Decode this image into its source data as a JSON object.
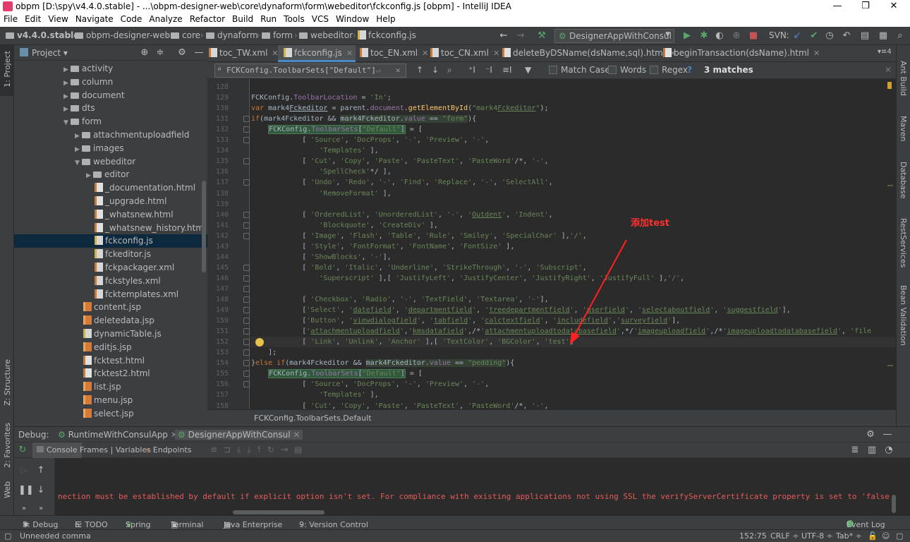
{
  "window": {
    "title": "obpm [D:\\spy\\v4.4.0.stable] - ...\\obpm-designer-web\\core\\dynaform\\form\\webeditor\\fckconfig.js [obpm] - IntelliJ IDEA",
    "minimize": "—",
    "maximize": "❐",
    "close": "✕"
  },
  "menu": [
    "File",
    "Edit",
    "View",
    "Navigate",
    "Code",
    "Analyze",
    "Refactor",
    "Build",
    "Run",
    "Tools",
    "VCS",
    "Window",
    "Help"
  ],
  "breadcrumb": [
    "v4.4.0.stable",
    "obpm-designer-web",
    "core",
    "dynaform",
    "form",
    "webeditor",
    "fckconfig.js"
  ],
  "run_config": "DesignerAppWithConsul",
  "svn_label": "SVN:",
  "left_strip": {
    "project": "1: Project",
    "structure": "Z: Structure",
    "favorites": "2: Favorites",
    "web": "Web"
  },
  "right_strip": [
    "Ant Build",
    "Maven",
    "Database",
    "RestServices",
    "Bean Validation"
  ],
  "project_panel": {
    "title": "Project",
    "items": [
      {
        "label": "activity",
        "type": "folder",
        "expanded": false
      },
      {
        "label": "column",
        "type": "folder",
        "expanded": false
      },
      {
        "label": "document",
        "type": "folder",
        "expanded": false
      },
      {
        "label": "dts",
        "type": "folder",
        "expanded": false
      },
      {
        "label": "form",
        "type": "folder",
        "expanded": true
      },
      {
        "label": "attachmentuploadfield",
        "type": "folder",
        "expanded": false
      },
      {
        "label": "images",
        "type": "folder",
        "expanded": false
      },
      {
        "label": "webeditor",
        "type": "folder",
        "expanded": true
      },
      {
        "label": "editor",
        "type": "folder",
        "expanded": false
      },
      {
        "label": "_documentation.html",
        "type": "html"
      },
      {
        "label": "_upgrade.html",
        "type": "html"
      },
      {
        "label": "_whatsnew.html",
        "type": "html"
      },
      {
        "label": "_whatsnew_history.html",
        "type": "html"
      },
      {
        "label": "fckconfig.js",
        "type": "js",
        "selected": true
      },
      {
        "label": "fckeditor.js",
        "type": "js"
      },
      {
        "label": "fckpackager.xml",
        "type": "xml"
      },
      {
        "label": "fckstyles.xml",
        "type": "xml"
      },
      {
        "label": "fcktemplates.xml",
        "type": "xml"
      },
      {
        "label": "content.jsp",
        "type": "jsp"
      },
      {
        "label": "deletedata.jsp",
        "type": "jsp"
      },
      {
        "label": "dynamicTable.js",
        "type": "js"
      },
      {
        "label": "editjs.jsp",
        "type": "jsp"
      },
      {
        "label": "fcktest.html",
        "type": "html"
      },
      {
        "label": "fcktest2.html",
        "type": "html"
      },
      {
        "label": "list.jsp",
        "type": "jsp"
      },
      {
        "label": "menu.jsp",
        "type": "jsp"
      },
      {
        "label": "select.jsp",
        "type": "jsp"
      }
    ]
  },
  "editor_tabs": [
    {
      "label": "toc_TW.xml"
    },
    {
      "label": "fckconfig.js",
      "active": true
    },
    {
      "label": "toc_EN.xml"
    },
    {
      "label": "toc_CN.xml"
    },
    {
      "label": "deleteByDSName(dsName,sql).html"
    },
    {
      "label": "beginTransaction(dsName).html"
    }
  ],
  "find": {
    "query": "FCKConfig.ToolbarSets[\"Default\"]",
    "match_case": "Match Case",
    "words": "Words",
    "regex": "Regex",
    "help": "?",
    "matches": "3 matches"
  },
  "code_lines": [
    {
      "n": "128",
      "html": ""
    },
    {
      "n": "129",
      "html": "FCKConfig.<span class=\"fld\">ToolbarLocation</span> = <span class=\"str\">'In'</span>;"
    },
    {
      "n": "130",
      "html": "<span class=\"kw\">var</span> mark4<u>Fckeditor</u> = parent.<span class=\"fld\">document</span>.<span class=\"fn\">getElementById</span>(<span class=\"str\">\"mark4<u>Fckeditor</u>\"</span>);"
    },
    {
      "n": "131",
      "html": "<span class=\"kw\">if</span>(mark4Fckeditor &amp;&amp; <span style=\"background:#344134\">mark4Fckeditor.<span class=\"fld\">value</span> == <span class=\"str\">\"form\"</span></span>){"
    },
    {
      "n": "132",
      "html": "    <span class=\"hl\">FCKConfig.<span class=\"fld\">ToolbarSets</span>[<span class=\"str\">\"Default\"</span>]</span> = ["
    },
    {
      "n": "133",
      "html": "            [ <span class=\"str\">'Source'</span>, <span class=\"str\">'DocProps'</span>, <span class=\"str\">'-'</span>, <span class=\"str\">'Preview'</span>, <span class=\"str\">'-'</span>,"
    },
    {
      "n": "134",
      "html": "                <span class=\"str\">'Templates'</span> ],"
    },
    {
      "n": "135",
      "html": "            [ <span class=\"str\">'Cut'</span>, <span class=\"str\">'Copy'</span>, <span class=\"str\">'Paste'</span>, <span class=\"str\">'PasteText'</span>, <span class=\"str\">'PasteWord'</span>/*, <span class=\"str\">'-'</span>,"
    },
    {
      "n": "136",
      "html": "                <span class=\"str\">'SpellCheck'</span>*/ ],"
    },
    {
      "n": "137",
      "html": "            [ <span class=\"str\">'Undo'</span>, <span class=\"str\">'Redo'</span>, <span class=\"str\">'-'</span>, <span class=\"str\">'Find'</span>, <span class=\"str\">'Replace'</span>, <span class=\"str\">'-'</span>, <span class=\"str\">'SelectAll'</span>,"
    },
    {
      "n": "138",
      "html": "                <span class=\"str\">'RemoveFormat'</span> ],"
    },
    {
      "n": "139",
      "html": ""
    },
    {
      "n": "140",
      "html": "            [ <span class=\"str\">'OrderedList'</span>, <span class=\"str\">'UnorderedList'</span>, <span class=\"str\">'-'</span>, <span class=\"str\">'<u>Outdent</u>'</span>, <span class=\"str\">'Indent'</span>,"
    },
    {
      "n": "141",
      "html": "                <span class=\"str\">'Blockquote'</span>, <span class=\"str\">'CreateDiv'</span> ],"
    },
    {
      "n": "142",
      "html": "            [ <span class=\"str\">'Image'</span>, <span class=\"str\">'Flash'</span>, <span class=\"str\">'Table'</span>, <span class=\"str\">'Rule'</span>, <span class=\"str\">'Smiley'</span>, <span class=\"str\">'SpecialChar'</span> ],<span class=\"str\">'/'</span>,"
    },
    {
      "n": "143",
      "html": "            [ <span class=\"str\">'Style'</span>, <span class=\"str\">'FontFormat'</span>, <span class=\"str\">'FontName'</span>, <span class=\"str\">'FontSize'</span> ],"
    },
    {
      "n": "144",
      "html": "            [ <span class=\"str\">'ShowBlocks'</span>, <span class=\"str\">'-'</span>],"
    },
    {
      "n": "145",
      "html": "            [ <span class=\"str\">'Bold'</span>, <span class=\"str\">'Italic'</span>, <span class=\"str\">'Underline'</span>, <span class=\"str\">'StrikeThrough'</span>, <span class=\"str\">'-'</span>, <span class=\"str\">'Subscript'</span>,"
    },
    {
      "n": "146",
      "html": "                <span class=\"str\">'Superscript'</span> ],[ <span class=\"str\">'JustifyLeft'</span>, <span class=\"str\">'JustifyCenter'</span>, <span class=\"str\">'JustifyRight'</span>, <span class=\"str\">'JustifyFull'</span> ],<span class=\"str\">'/'</span>,"
    },
    {
      "n": "147",
      "html": ""
    },
    {
      "n": "148",
      "html": "            [ <span class=\"str\">'Checkbox'</span>, <span class=\"str\">'Radio'</span>, <span class=\"str\">'-'</span>, <span class=\"str\">'TextField'</span>, <span class=\"str\">'Textarea'</span>, <span class=\"str\">'-'</span>],"
    },
    {
      "n": "149",
      "html": "            [<span class=\"str\">'Select'</span>, <span class=\"str\">'<u>datefield</u>'</span>, <span class=\"str\">'<u>departmentfield</u>'</span>, <span class=\"str\">'<u>treedepartmentfield</u>'</span>, <span class=\"str\">'<u>userfield</u>'</span>, <span class=\"str\">'<u>selectaboutfield</u>'</span>, <span class=\"str\">'<u>suggestfield</u>'</span>],"
    },
    {
      "n": "150",
      "html": "            [<span class=\"str\">'Button'</span>, <span class=\"str\">'<u>viewdialogfield</u>'</span>, <span class=\"str\">'<u>tabfield</u>'</span>, <span class=\"str\">'<u>calctextfield</u>'</span>, <span class=\"str\">'<u>includefield</u>'</span>,<span class=\"str\">'<u>surveyfield</u>'</span>],"
    },
    {
      "n": "151",
      "html": "            [<span class=\"str\">'<u>attachmentuploadfield</u>'</span>,<span class=\"str\">'<u>kmsdatafield</u>'</span>,/*<span class=\"str\">'<u>attachmentuploadtodatabasefield</u>'</span>,*/<span class=\"str\">'<u>imageuploadfield</u>'</span>,/*<span class=\"str\">'<u>imageuploadtodatabasefield</u>'</span>, <span class=\"str\">'file</span>"
    },
    {
      "n": "152",
      "html": "            [ <span class=\"str\">'Link'</span>, <span class=\"str\">'Unlink'</span>, <span class=\"str\">'Anchor'</span> ],[ <span class=\"str\">'TextColor'</span>, <span class=\"str\">'BGColor'</span>, <span class=\"str\">'test'</span>]",
      "current": true
    },
    {
      "n": "153",
      "html": "    ];"
    },
    {
      "n": "154",
      "html": "}<span class=\"kw\">else if</span>(mark4Fckeditor &amp;&amp; <span style=\"background:#344134\">mark4Fckeditor.<span class=\"fld\">value</span> == <span class=\"str\">\"pedding\"</span></span>){"
    },
    {
      "n": "155",
      "html": "    <span class=\"hl\">FCKConfig.<span class=\"fld\">ToolbarSets</span>[<span class=\"str\">\"Default\"</span>]</span> = ["
    },
    {
      "n": "156",
      "html": "            [ <span class=\"str\">'Source'</span>, <span class=\"str\">'DocProps'</span>, <span class=\"str\">'-'</span>, <span class=\"str\">'Preview'</span>, <span class=\"str\">'-'</span>,"
    },
    {
      "n": "157",
      "html": "                <span class=\"str\">'Templates'</span> ],"
    },
    {
      "n": "158",
      "html": "            [ <span class=\"str\">'Cut'</span>, <span class=\"str\">'Copy'</span>, <span class=\"str\">'Paste'</span>, <span class=\"str\">'PasteText'</span>, <span class=\"str\">'PasteWord'</span>/*, <span class=\"str\">'-'</span>,"
    }
  ],
  "editor_breadcrumb": "FCKConfig.ToolbarSets.Default",
  "annotation": "添加test",
  "debug": {
    "label": "Debug:",
    "sessions": [
      "RuntimeWithConsulApp",
      "DesignerAppWithConsul"
    ],
    "tabs": [
      "Console",
      "Frames | Variables",
      "Endpoints"
    ],
    "console_text": "nection must be established by default if explicit option isn't set. For compliance with existing applications not using SSL the verifyServerCertificate property is set to 'false'. You need"
  },
  "bottom_tools": [
    "5: Debug",
    "6: TODO",
    "Spring",
    "Terminal",
    "Java Enterprise",
    "9: Version Control",
    "Event Log"
  ],
  "status": {
    "message": "Unneeded comma",
    "position": "152:75",
    "line_sep": "CRLF ÷",
    "encoding": "UTF-8 ÷",
    "indent": "Tab* ÷"
  },
  "colors": {
    "accent": "#4a88c7",
    "selection": "#0d293e",
    "annotation": "#ff3030",
    "editor_bg": "#2b2b2b"
  }
}
